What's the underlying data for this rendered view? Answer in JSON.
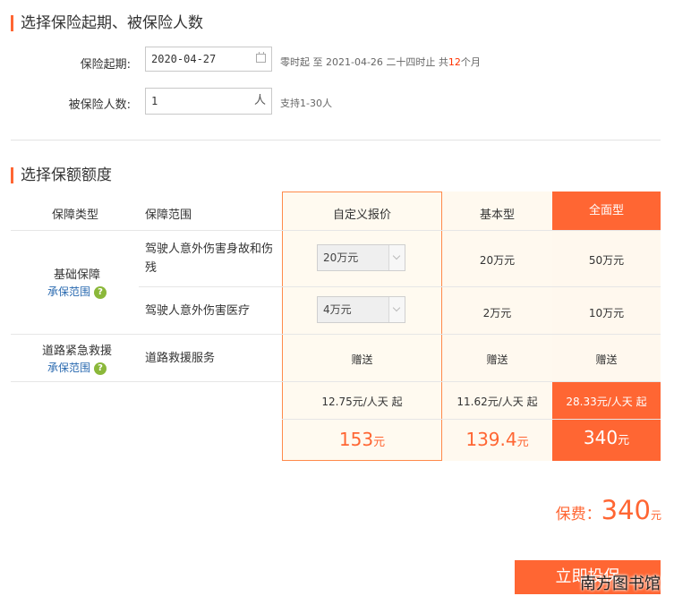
{
  "section1": {
    "title": "选择保险起期、被保险人数"
  },
  "start": {
    "label": "保险起期:",
    "value": "2020-04-27",
    "hint_prefix": "零时起 至 2021-04-26 二十四时止 共",
    "hint_months": "12",
    "hint_suffix": "个月"
  },
  "insured": {
    "label": "被保险人数:",
    "value": "1",
    "unit": "人",
    "hint": "支持1-30人"
  },
  "section2": {
    "title": "选择保额额度"
  },
  "table": {
    "headers": {
      "type": "保障类型",
      "scope": "保障范围",
      "custom": "自定义报价",
      "basic": "基本型",
      "full": "全面型"
    },
    "basic_cat": {
      "name": "基础保障",
      "link": "承保范围"
    },
    "road_cat": {
      "name": "道路紧急救援",
      "link": "承保范围"
    },
    "rows": [
      {
        "scope": "驾驶人意外伤害身故和伤残",
        "custom": "20万元",
        "basic": "20万元",
        "full": "50万元"
      },
      {
        "scope": "驾驶人意外伤害医疗",
        "custom": "4万元",
        "basic": "2万元",
        "full": "10万元"
      },
      {
        "scope": "道路救援服务",
        "custom": "赠送",
        "basic": "赠送",
        "full": "赠送"
      }
    ],
    "per_day": {
      "custom": "12.75元/人天 起",
      "basic": "11.62元/人天 起",
      "full": "28.33元/人天 起"
    },
    "totals": {
      "custom": "153",
      "basic": "139.4",
      "full": "340",
      "unit": "元"
    }
  },
  "premium": {
    "label": "保费：",
    "value": "340",
    "unit": "元"
  },
  "buy_button": "立即投保",
  "watermark": "南方图书馆",
  "colors": {
    "accent": "#ff6633",
    "link": "#2a6ab0",
    "badge": "#8bb83a"
  }
}
